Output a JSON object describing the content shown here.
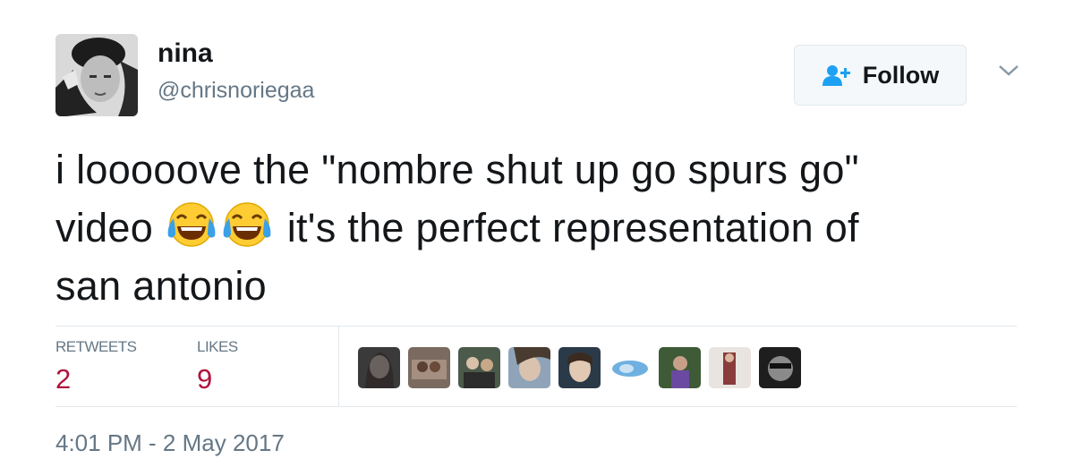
{
  "user": {
    "display_name": "nina",
    "handle": "@chrisnoriegaa",
    "avatar_icon": "profile-photo"
  },
  "follow_button": {
    "label": "Follow",
    "icon": "follow-user-icon"
  },
  "menu_caret_icon": "chevron-down-icon",
  "tweet": {
    "line1": "i looooove the \"nombre shut up go spurs go\"",
    "line2_before": "video",
    "line2_after": "it's the perfect representation of",
    "line3": "san antonio",
    "emojis": [
      "face-with-tears-of-joy",
      "face-with-tears-of-joy"
    ]
  },
  "stats": {
    "retweets_label": "RETWEETS",
    "retweets_count": "2",
    "likes_label": "LIKES",
    "likes_count": "9"
  },
  "likers_count": 9,
  "timestamp": "4:01 PM - 2 May 2017",
  "colors": {
    "count_accent": "#b0133c",
    "follow_icon": "#1da1f2",
    "secondary_text": "#657786",
    "divider": "#e1e8ed"
  }
}
